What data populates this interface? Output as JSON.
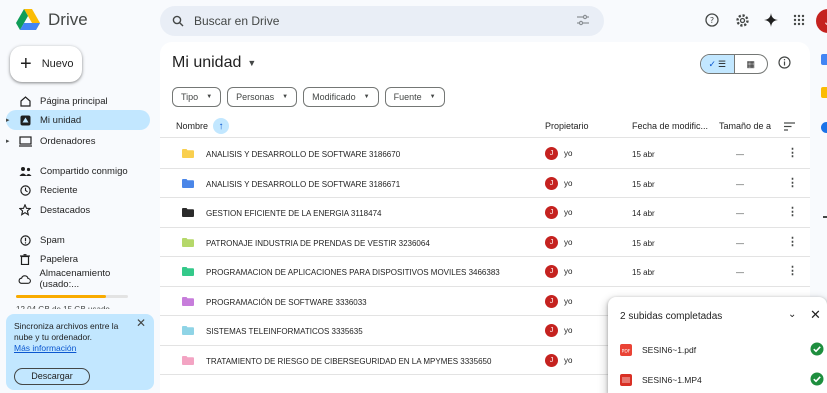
{
  "app": {
    "name": "Drive"
  },
  "search": {
    "placeholder": "Buscar en Drive"
  },
  "user": {
    "avatar_letter": "J",
    "avatar_color": "#c5221f"
  },
  "new_button": {
    "label": "Nuevo"
  },
  "sidebar": {
    "items": [
      {
        "label": "Página principal",
        "icon": "home-icon"
      },
      {
        "label": "Mi unidad",
        "icon": "my-drive-icon",
        "active": true
      },
      {
        "label": "Ordenadores",
        "icon": "computer-icon"
      },
      {
        "label": "Compartido conmigo",
        "icon": "shared-icon"
      },
      {
        "label": "Reciente",
        "icon": "clock-icon"
      },
      {
        "label": "Destacados",
        "icon": "star-icon"
      },
      {
        "label": "Spam",
        "icon": "spam-icon"
      },
      {
        "label": "Papelera",
        "icon": "trash-icon"
      },
      {
        "label": "Almacenamiento (usado:...",
        "icon": "cloud-icon"
      }
    ],
    "storage_text": "12,04 GB de 15 GB usado",
    "storage_fraction": 0.8
  },
  "promo": {
    "text": "Sincroniza archivos entre la nube y tu ordenador.",
    "link": "Más información",
    "button": "Descargar"
  },
  "main": {
    "title": "Mi unidad",
    "filters": [
      "Tipo",
      "Personas",
      "Modificado",
      "Fuente"
    ],
    "columns": {
      "name": "Nombre",
      "owner": "Propietario",
      "modified": "Fecha de modific...",
      "size": "Tamaño de a"
    },
    "rows": [
      {
        "name": "ANALISIS Y DESARROLLO DE SOFTWARE 3186670",
        "owner": "yo",
        "date": "15 abr",
        "size": "—",
        "color": "#f9cf4e"
      },
      {
        "name": "ANALISIS Y DESARROLLO DE SOFTWARE 3186671",
        "owner": "yo",
        "date": "15 abr",
        "size": "—",
        "color": "#4a86e8"
      },
      {
        "name": "GESTION EFICIENTE DE LA ENERGIA 3118474",
        "owner": "yo",
        "date": "14 abr",
        "size": "—",
        "color": "#2b2b2b"
      },
      {
        "name": "PATRONAJE INDUSTRIA DE PRENDAS DE VESTIR 3236064",
        "owner": "yo",
        "date": "15 abr",
        "size": "—",
        "color": "#b5d86a"
      },
      {
        "name": "PROGRAMACION DE APLICACIONES PARA DISPOSITIVOS MOVILES 3466383",
        "owner": "yo",
        "date": "15 abr",
        "size": "—",
        "color": "#34c98a"
      },
      {
        "name": "PROGRAMACIÓN DE SOFTWARE 3336033",
        "owner": "yo",
        "date": "",
        "size": "",
        "color": "#c77ddb"
      },
      {
        "name": "SISTEMAS TELEINFORMATICOS 3335635",
        "owner": "yo",
        "date": "",
        "size": "",
        "color": "#8fd4e6"
      },
      {
        "name": "TRATAMIENTO DE RIESGO DE CIBERSEGURIDAD EN LA MPYMES 3335650",
        "owner": "yo",
        "date": "",
        "size": "",
        "color": "#f3a4c3"
      }
    ]
  },
  "uploads": {
    "title": "2 subidas completadas",
    "items": [
      {
        "name": "SESIN6~1.pdf",
        "icon": "pdf-icon"
      },
      {
        "name": "SESIN6~1.MP4",
        "icon": "video-icon"
      }
    ]
  }
}
